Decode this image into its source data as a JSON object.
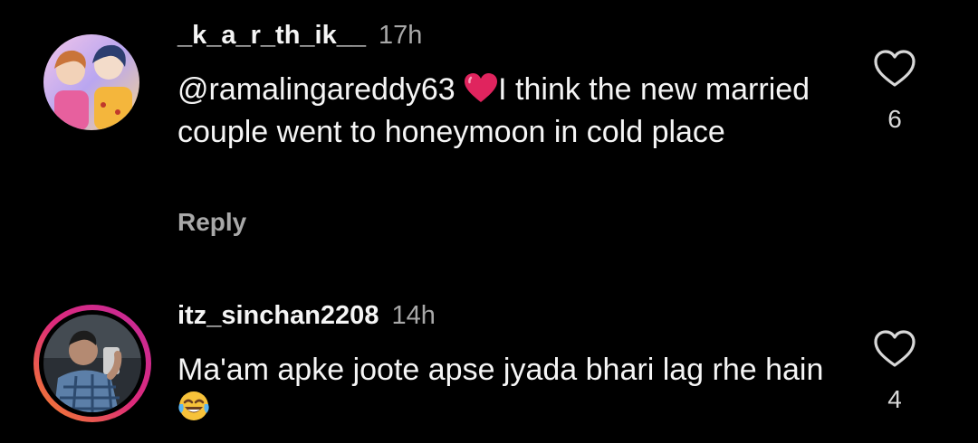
{
  "comments": [
    {
      "username": "_k_a_r_th_ik__",
      "time": "17h",
      "mention": "@ramalingareddy63",
      "text_after_emoji": "I think the new married couple went to honeymoon in cold place",
      "emoji": "red-heart",
      "reply_label": "Reply",
      "like_count": "6"
    },
    {
      "username": "itz_sinchan2208",
      "time": "14h",
      "text_before_emoji": "Ma'am apke joote apse jyada bhari lag rhe hain",
      "emoji": "tears-of-joy",
      "like_count": "4"
    }
  ],
  "colors": {
    "background": "#000000",
    "text": "#f5f5f5",
    "secondary": "#a8a8a8",
    "heart_emoji": "#e0245e",
    "story_ring_start": "#f58529",
    "story_ring_end": "#dd2a7b"
  }
}
